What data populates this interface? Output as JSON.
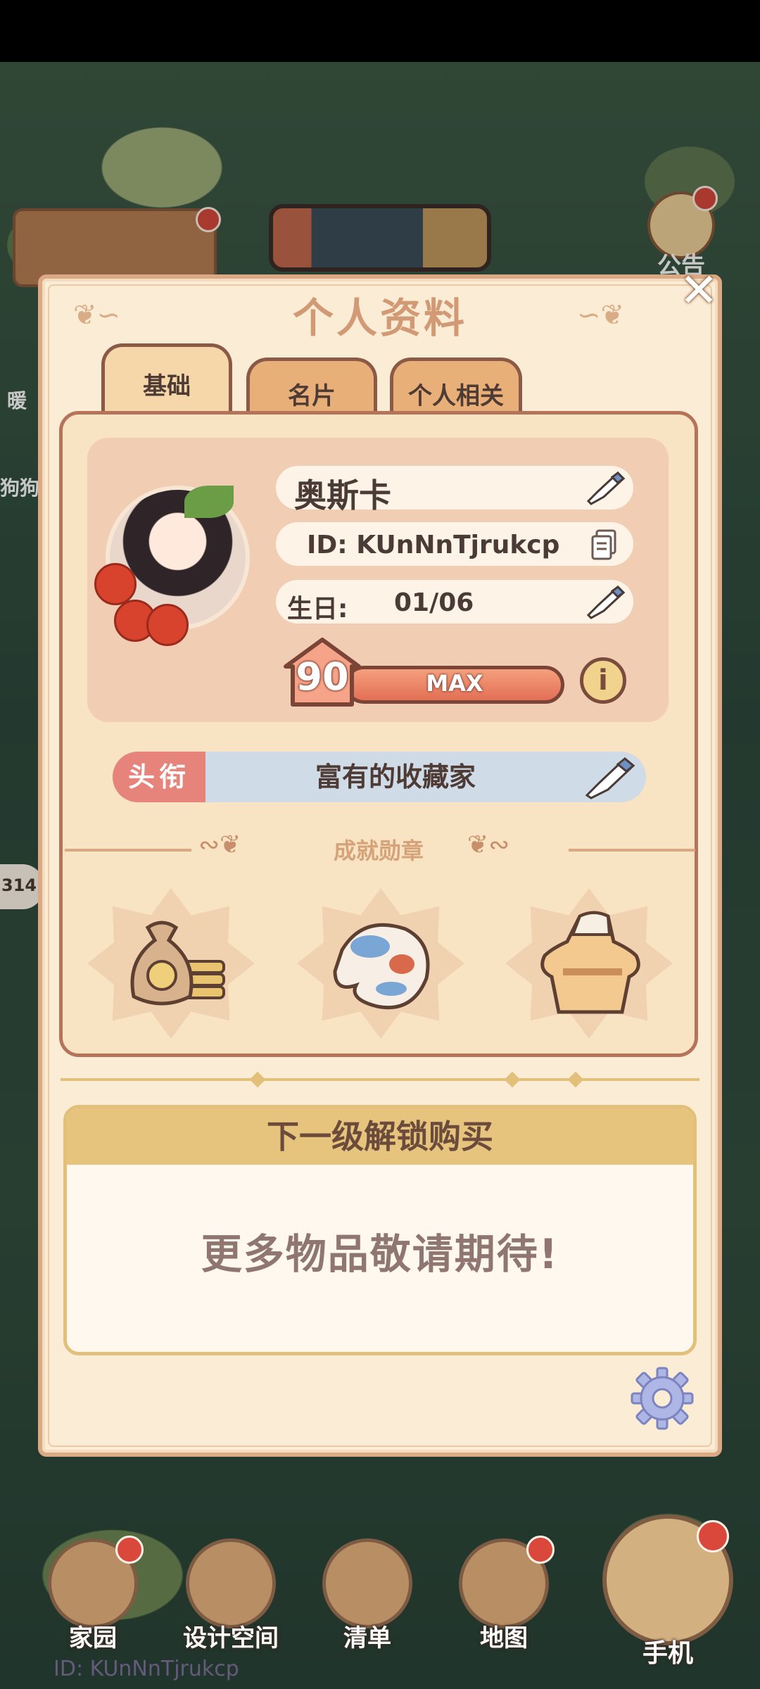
{
  "background": {
    "notice_label": "公告",
    "side_label_1": "暖",
    "side_label_2": "狗狗",
    "side_pill_text": "314"
  },
  "modal": {
    "title": "个人资料",
    "tabs": [
      {
        "label": "基础",
        "active": true
      },
      {
        "label": "名片",
        "active": false
      },
      {
        "label": "个人相关",
        "active": false
      }
    ],
    "profile": {
      "name": "奥斯卡",
      "id_text": "ID: KUnNnTjrukcp",
      "birthday_label": "生日:",
      "birthday_value": "01/06",
      "level": "90",
      "level_status": "MAX",
      "info_glyph": "i"
    },
    "player_title": {
      "tag": "头衔",
      "value": "富有的收藏家"
    },
    "achievements": {
      "label": "成就勋章",
      "medals": [
        "coin-bag-medal-icon",
        "koi-fish-medal-icon",
        "dress-medal-icon"
      ]
    },
    "unlock": {
      "heading": "下一级解锁购买",
      "message": "更多物品敬请期待!"
    }
  },
  "bottom_nav": [
    {
      "label": "家园",
      "has_badge": true
    },
    {
      "label": "设计空间",
      "has_badge": false
    },
    {
      "label": "清单",
      "has_badge": false
    },
    {
      "label": "地图",
      "has_badge": true
    },
    {
      "label": "手机",
      "has_badge": true
    }
  ],
  "footer_id": "ID: KUnNnTjrukcp",
  "colors": {
    "modal_bg": "#fbecd6",
    "title_color": "#d19a74",
    "badge_red": "#d9483b",
    "title_tag": "#e6837a",
    "title_bar": "#cfdbe6",
    "unlock_header": "#e6c47d"
  }
}
